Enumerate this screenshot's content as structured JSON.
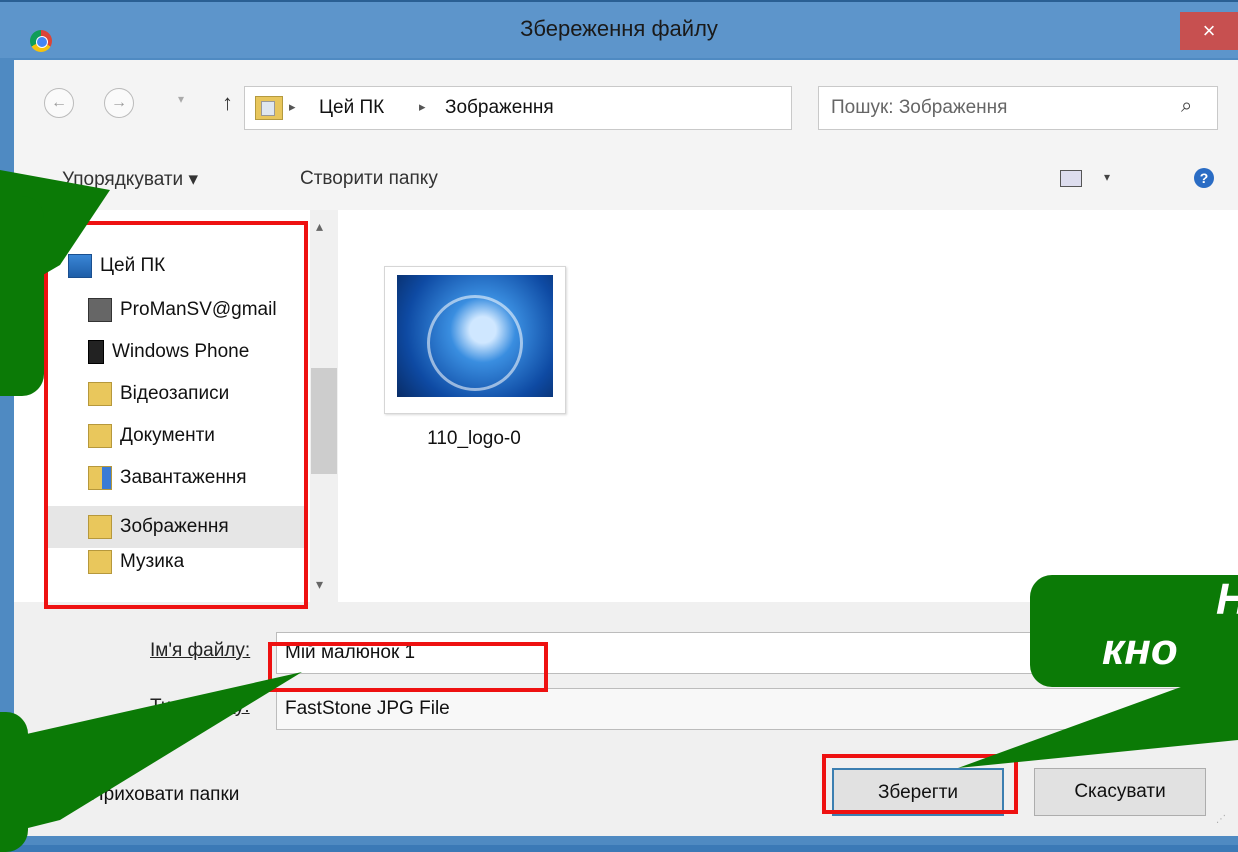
{
  "window": {
    "title": "Збереження файлу",
    "close_label": "×"
  },
  "address_bar": {
    "back_label": "←",
    "forward_label": "→",
    "up_label": "↑",
    "crumbs": [
      "Цей ПК",
      "Зображення"
    ],
    "separator": "▸",
    "dropdown_label": "∨",
    "refresh_label": "↻",
    "search_placeholder": "Пошук: Зображення",
    "search_icon": "⌕"
  },
  "toolbar": {
    "organize_label": "Упорядкувати ▾",
    "new_folder_label": "Створити папку",
    "view_dropdown": "▾",
    "help_label": "?"
  },
  "nav_tree": {
    "items": [
      {
        "label": "Цей ПК",
        "icon": "computer-icon"
      },
      {
        "label": "ProManSV@gmail",
        "icon": "network-device-icon"
      },
      {
        "label": "Windows Phone",
        "icon": "phone-icon"
      },
      {
        "label": "Відеозаписи",
        "icon": "videos-folder-icon"
      },
      {
        "label": "Документи",
        "icon": "documents-folder-icon"
      },
      {
        "label": "Завантаження",
        "icon": "downloads-folder-icon"
      },
      {
        "label": "Зображення",
        "icon": "pictures-folder-icon"
      },
      {
        "label": "Музика",
        "icon": "music-folder-icon"
      }
    ],
    "scroll_up": "▴",
    "scroll_down": "▾"
  },
  "content": {
    "files": [
      {
        "name": "110_logo-0"
      }
    ]
  },
  "form": {
    "filename_label": "Ім'я файлу:",
    "filename_value": "Мій малюнок 1",
    "filetype_label": "Тип файлу:",
    "filetype_value": "FastStone JPG File",
    "hide_folders_label": "Приховати папки",
    "hide_folders_icon": "▲",
    "save_label": "Зберегти",
    "cancel_label": "Скасувати"
  },
  "callout": {
    "text_line1": "Н",
    "text_line2": "кно"
  },
  "colors": {
    "callout_green": "#0b7a06",
    "highlight_red": "#ee1111",
    "title_bar_blue": "#5d95cb",
    "close_red": "#c75050"
  }
}
